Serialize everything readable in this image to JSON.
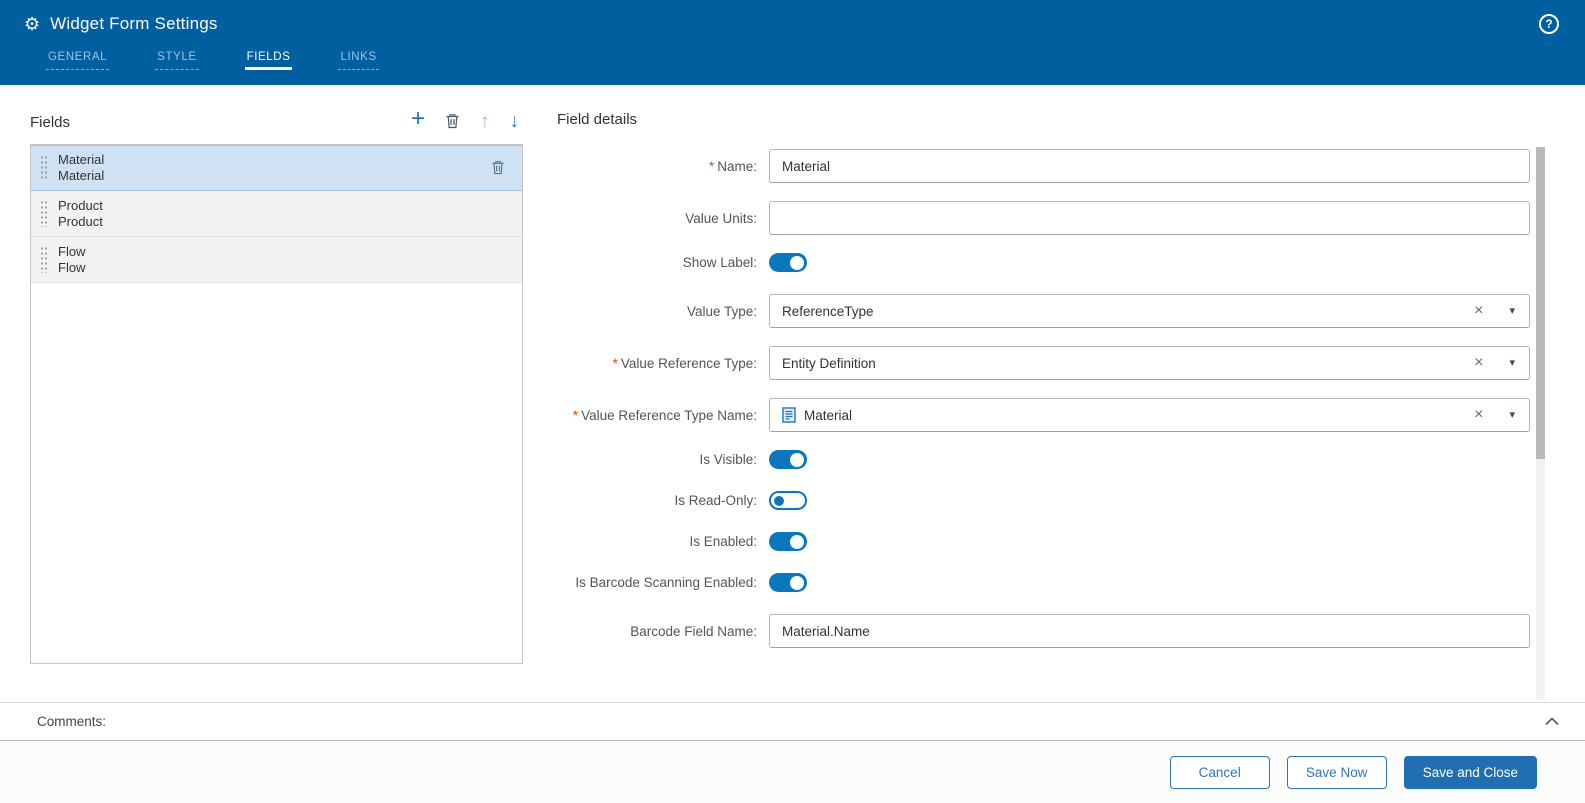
{
  "ui": {
    "required_marker": "*",
    "icons": {
      "gear": "⚙",
      "help": "?",
      "plus": "+",
      "move_up": "↑",
      "move_down": "↓",
      "clear": "×",
      "caret": "▾"
    }
  },
  "header": {
    "title": "Widget Form Settings"
  },
  "tabs": [
    {
      "label": "GENERAL",
      "active": false
    },
    {
      "label": "STYLE",
      "active": false
    },
    {
      "label": "FIELDS",
      "active": true
    },
    {
      "label": "LINKS",
      "active": false
    }
  ],
  "fields_panel": {
    "title": "Fields",
    "items": [
      {
        "line1": "Material",
        "line2": "Material",
        "selected": true
      },
      {
        "line1": "Product",
        "line2": "Product",
        "selected": false
      },
      {
        "line1": "Flow",
        "line2": "Flow",
        "selected": false
      }
    ]
  },
  "details": {
    "title": "Field details",
    "name": {
      "label": "Name:",
      "required": true,
      "value": "Material"
    },
    "value_units": {
      "label": "Value Units:",
      "required": false,
      "value": ""
    },
    "show_label": {
      "label": "Show Label:",
      "on": true
    },
    "value_type": {
      "label": "Value Type:",
      "required": false,
      "value": "ReferenceType"
    },
    "value_reference_type": {
      "label": "Value Reference Type:",
      "required": true,
      "value": "Entity Definition"
    },
    "value_reference_type_name": {
      "label": "Value Reference Type Name:",
      "required": true,
      "value": "Material"
    },
    "is_visible": {
      "label": "Is Visible:",
      "on": true
    },
    "is_read_only": {
      "label": "Is Read-Only:",
      "on": false
    },
    "is_enabled": {
      "label": "Is Enabled:",
      "on": true
    },
    "is_barcode_scanning_enabled": {
      "label": "Is Barcode Scanning Enabled:",
      "on": true
    },
    "barcode_field_name": {
      "label": "Barcode Field Name:",
      "required": false,
      "value": "Material.Name"
    }
  },
  "comments": {
    "label": "Comments:"
  },
  "footer": {
    "cancel_label": "Cancel",
    "save_now_label": "Save Now",
    "save_and_close_label": "Save and Close"
  },
  "colors": {
    "header_bg": "#005f9e",
    "accent": "#0a76bd",
    "primary_button": "#1f6fb2",
    "required_marker": "#c75310",
    "selected_item_bg": "#cfe2f4"
  }
}
